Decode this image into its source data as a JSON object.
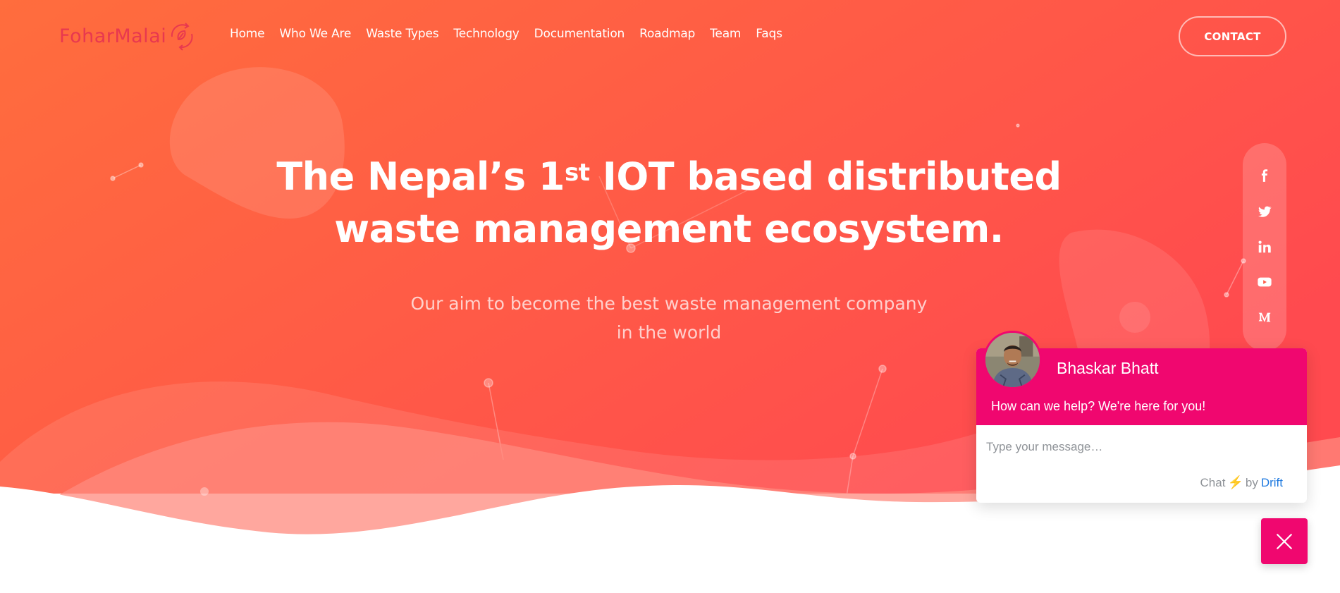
{
  "brand": {
    "name": "FoharMalai",
    "accent": "#e8384f"
  },
  "nav": {
    "items": [
      "Home",
      "Who We Are",
      "Waste Types",
      "Technology",
      "Documentation",
      "Roadmap",
      "Team",
      "Faqs"
    ],
    "contact_label": "CONTACT"
  },
  "hero": {
    "headline_part1": "The Nepal’s 1",
    "headline_sup": "st",
    "headline_part2": " IOT based distributed",
    "headline_line2": "waste management ecosystem.",
    "subline_1": "Our aim to become the best waste management company",
    "subline_2": "in the world",
    "gradient_from": "#ff6a3d",
    "gradient_to": "#ff4a4f"
  },
  "social": [
    {
      "name": "facebook-icon",
      "glyph": "f"
    },
    {
      "name": "twitter-icon",
      "glyph": "twitter"
    },
    {
      "name": "linkedin-icon",
      "glyph": "in"
    },
    {
      "name": "youtube-icon",
      "glyph": "youtube"
    },
    {
      "name": "medium-icon",
      "glyph": "M"
    }
  ],
  "chat": {
    "agent_name": "Bhaskar Bhatt",
    "help_text": "How can we help? We're here for you!",
    "input_placeholder": "Type your message…",
    "credit_chat": "Chat",
    "credit_bolt": "⚡",
    "credit_by": "by",
    "credit_brand": "Drift",
    "header_color": "#f0076f"
  }
}
